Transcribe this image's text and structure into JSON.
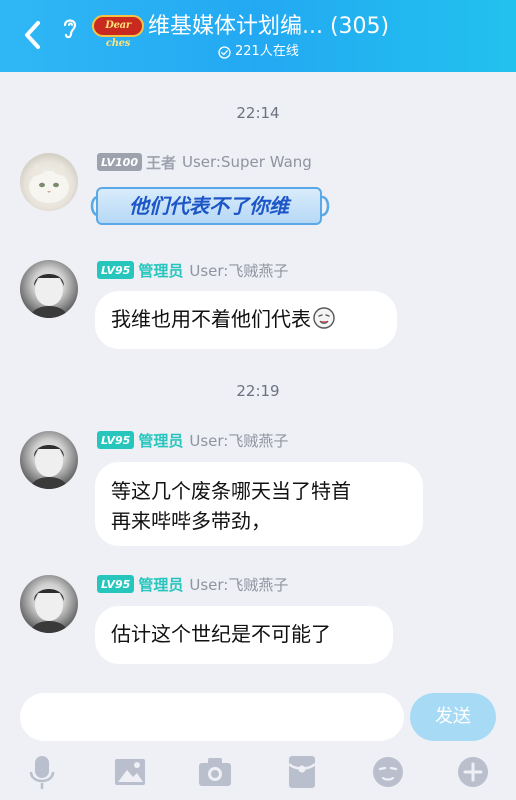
{
  "header": {
    "title": "维基媒体计划编... (305)",
    "logo_text": "Dear ches",
    "online": "221人在线"
  },
  "messages": [
    {
      "time": "22:14",
      "level": "LV100",
      "role": "王者",
      "user": "User:Super Wang",
      "text": "他们代表不了你维",
      "style": "special-bubble",
      "avatar": "white-cat-avatar"
    },
    {
      "level": "LV95",
      "role": "管理员",
      "user": "User:飞贼燕子",
      "text": "我维也用不着他们代表",
      "trailing_emoji": "sticker-emoji",
      "avatar": "user-avatar"
    },
    {
      "time": "22:19",
      "level": "LV95",
      "role": "管理员",
      "user": "User:飞贼燕子",
      "text_lines": [
        "等这几个废条哪天当了特首",
        "再来哔哔多带劲，"
      ],
      "avatar": "user-avatar"
    },
    {
      "level": "LV95",
      "role": "管理员",
      "user": "User:飞贼燕子",
      "text": "估计这个世纪是不可能了",
      "avatar": "user-avatar"
    }
  ],
  "composer": {
    "placeholder": "",
    "send_label": "发送"
  },
  "toolbar": [
    "microphone-icon",
    "image-icon",
    "camera-icon",
    "red-packet-icon",
    "emoji-icon",
    "plus-icon"
  ],
  "colors": {
    "header_gradient_start": "#2fb7f5",
    "header_gradient_end": "#22c2ee",
    "admin_teal": "#27c6bd",
    "level_grey": "#9ea2ad",
    "send_button": "#a7dbf5"
  }
}
